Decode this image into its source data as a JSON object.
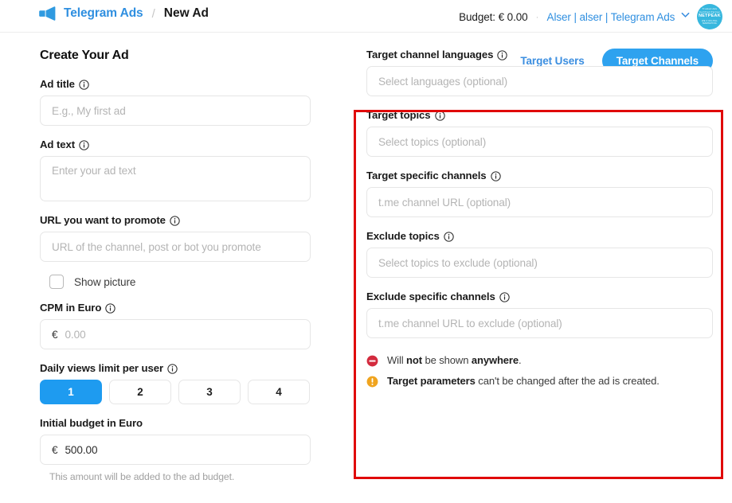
{
  "header": {
    "logo_icon": "megaphone-icon",
    "brand": "Telegram Ads",
    "separator": "/",
    "current_page": "New Ad",
    "budget_label": "Budget: € 0.00",
    "dot": "·",
    "account": "Alser | alser | Telegram Ads",
    "chevron_icon": "chevron-down-icon",
    "avatar_top": "Trusted Ads Certified Partner",
    "avatar_name": "NETPEAK",
    "avatar_sub": "WE 3 DIGITAL MARKETING"
  },
  "main": {
    "section_title": "Create Your Ad",
    "tabs": [
      {
        "label": "Target Users",
        "active": false
      },
      {
        "label": "Target Channels",
        "active": true
      }
    ]
  },
  "left_form": {
    "ad_title": {
      "label": "Ad title",
      "info_icon": "info-icon",
      "placeholder": "E.g., My first ad",
      "value": ""
    },
    "ad_text": {
      "label": "Ad text",
      "info_icon": "info-icon",
      "placeholder": "Enter your ad text",
      "value": ""
    },
    "url": {
      "label": "URL you want to promote",
      "info_icon": "info-icon",
      "placeholder": "URL of the channel, post or bot you promote",
      "value": ""
    },
    "show_picture": {
      "label": "Show picture",
      "checked": false
    },
    "cpm": {
      "label": "CPM in Euro",
      "info_icon": "info-icon",
      "currency": "€",
      "placeholder": "0.00",
      "value": ""
    },
    "daily_views": {
      "label": "Daily views limit per user",
      "info_icon": "info-icon",
      "options": [
        "1",
        "2",
        "3",
        "4"
      ],
      "selected": "1"
    },
    "initial_budget": {
      "label": "Initial budget in Euro",
      "currency": "€",
      "value": "500.00",
      "helper": "This amount will be added to the ad budget."
    }
  },
  "right_form": {
    "target_languages": {
      "label": "Target channel languages",
      "info_icon": "info-icon",
      "placeholder": "Select languages (optional)",
      "value": ""
    },
    "target_topics": {
      "label": "Target topics",
      "info_icon": "info-icon",
      "placeholder": "Select topics (optional)",
      "value": ""
    },
    "target_channels": {
      "label": "Target specific channels",
      "info_icon": "info-icon",
      "placeholder": "t.me channel URL (optional)",
      "value": ""
    },
    "exclude_topics": {
      "label": "Exclude topics",
      "info_icon": "info-icon",
      "placeholder": "Select topics to exclude (optional)",
      "value": ""
    },
    "exclude_channels": {
      "label": "Exclude specific channels",
      "info_icon": "info-icon",
      "placeholder": "t.me channel URL to exclude (optional)",
      "value": ""
    },
    "notes": [
      {
        "icon": "minus-circle-icon",
        "icon_color": "#d32b3e",
        "text_pre": "Will ",
        "bold1": "not",
        "text_mid": " be shown ",
        "bold2": "anywhere",
        "text_post": "."
      },
      {
        "icon": "exclamation-circle-icon",
        "icon_color": "#f0a41e",
        "bold1": "Target parameters",
        "text_post": " can't be changed after the ad is created."
      }
    ]
  },
  "annotation": {
    "name": "red-highlight-rectangle",
    "color": "#e00a0a"
  }
}
